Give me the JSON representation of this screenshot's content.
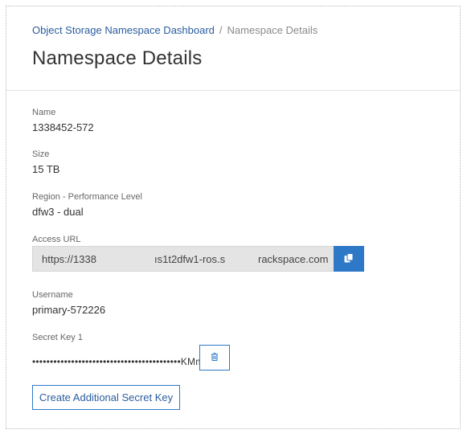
{
  "breadcrumb": {
    "parent_label": "Object Storage Namespace Dashboard",
    "separator": "/",
    "current_label": "Namespace Details"
  },
  "page_title": "Namespace Details",
  "fields": {
    "name": {
      "label": "Name",
      "value": "1338452-572"
    },
    "size": {
      "label": "Size",
      "value": "15 TB"
    },
    "region": {
      "label": "Region - Performance Level",
      "value": "dfw3 - dual"
    },
    "access_url": {
      "label": "Access URL",
      "segments": [
        "https://1338",
        "ıs1t2dfw1-ros.s",
        "rackspace.com"
      ]
    },
    "username": {
      "label": "Username",
      "value": "primary-572226"
    },
    "secret_key": {
      "label": "Secret Key 1",
      "value": "••••••••••••••••••••••••••••••••••••••••••KMmQ"
    }
  },
  "buttons": {
    "create_secret_key_label": "Create Additional Secret Key"
  },
  "icons": {
    "copy": "copy-icon",
    "delete": "trash-icon"
  },
  "colors": {
    "link": "#2a5d9f",
    "accent": "#2e78c8",
    "url_background": "#e4e4e4",
    "muted_text": "#8a8a8a"
  }
}
